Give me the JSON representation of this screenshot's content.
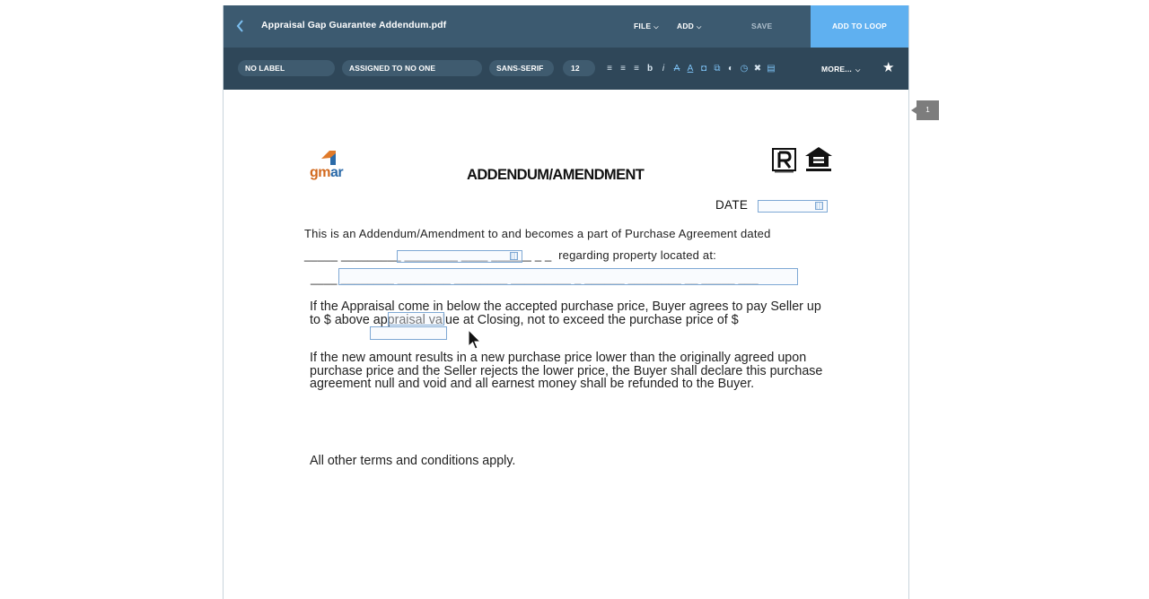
{
  "header": {
    "document_title": "Appraisal Gap Guarantee Addendum.pdf",
    "file_menu": "FILE",
    "add_menu": "ADD",
    "save": "SAVE",
    "add_to_loop": "ADD TO LOOP"
  },
  "toolbar": {
    "label_select": "NO LABEL",
    "assigned_select": "ASSIGNED TO NO ONE",
    "font_select": "SANS-SERIF",
    "size_select": "12",
    "more": "MORE...",
    "tools": [
      {
        "icon": "align-left-icon",
        "glyph": "≡"
      },
      {
        "icon": "align-center-icon",
        "glyph": "≡"
      },
      {
        "icon": "align-right-icon",
        "glyph": "≡"
      },
      {
        "icon": "bold-icon",
        "glyph": "b"
      },
      {
        "icon": "italic-icon",
        "glyph": "i"
      },
      {
        "icon": "strikethrough-icon",
        "glyph": "A"
      },
      {
        "icon": "underline-icon",
        "glyph": "A"
      },
      {
        "icon": "fill-color-icon",
        "glyph": "◘"
      },
      {
        "icon": "copy-icon",
        "glyph": "⧉"
      },
      {
        "icon": "contrast-icon",
        "glyph": "◐"
      },
      {
        "icon": "clock-icon",
        "glyph": "◷"
      },
      {
        "icon": "delete-icon",
        "glyph": "✖"
      },
      {
        "icon": "grid-icon",
        "glyph": "▤"
      }
    ],
    "accent": "#5fb0f0"
  },
  "page_tab": "1",
  "document": {
    "logo_text_g": "gm",
    "logo_text_r": "ar",
    "heading": "ADDENDUM/AMENDMENT",
    "date_label": "DATE",
    "intro": "This is an Addendum/Amendment to and becomes a part of Purchase Agreement dated",
    "regarding_line": "_____ _________ ________ ____ ______ _ _  regarding property located at:",
    "underline_row": "____ ________ ________ ________ _________ _ ______ ________ __ _____ ___",
    "para_a": "If the Appraisal come in below the accepted purchase price, Buyer agrees to pay Seller up to $               above appraisal value at Closing, not to exceed the purchase price of $",
    "para_b": "If the new amount results in a new purchase price lower than the originally agreed upon purchase price and the Seller rejects the lower price, the Buyer shall declare this purchase agreement null and void and all earnest money shall be refunded to the Buyer.",
    "para_c": "All other terms and conditions apply."
  }
}
